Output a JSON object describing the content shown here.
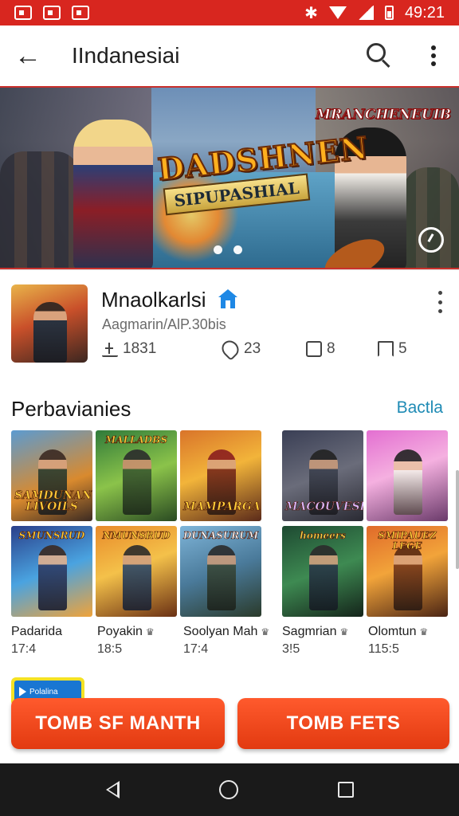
{
  "status_bar": {
    "time": "49:21"
  },
  "app_bar": {
    "title": "IIndanesiai"
  },
  "banner": {
    "title_line1": "DADSHNEN",
    "title_line2": "SIPUPASHIAL",
    "corner_badge": "MRANCHENEUIB"
  },
  "app": {
    "name": "Mnaolkarlsi",
    "subtitle": "Aagmarin/AlP.30bis",
    "stats": {
      "downloads": "1831",
      "likes": "23",
      "boxes": "8",
      "saves": "5"
    }
  },
  "section": {
    "title": "Perbavianies",
    "link": "Bactla"
  },
  "tiles": [
    {
      "caption": "SAMDUNAN LIVOILS",
      "name": "",
      "meta": ""
    },
    {
      "caption": "MALLADBS",
      "name": "",
      "meta": ""
    },
    {
      "caption": "MAMPARGA",
      "name": "",
      "meta": ""
    },
    {
      "caption": "MACOUVESER",
      "name": "",
      "meta": ""
    },
    {
      "caption": "",
      "name": "",
      "meta": ""
    },
    {
      "caption": "SMUNSRUD",
      "name": "Padarida",
      "meta": "17:4"
    },
    {
      "caption": "NMUNSRUD",
      "name": "Poyakin",
      "meta": "18:5"
    },
    {
      "caption": "DUNASURUM",
      "name": "Soolyan Mah",
      "meta": "17:4"
    },
    {
      "caption": "homeers",
      "name": "Sagmrian",
      "meta": "3!5"
    },
    {
      "caption": "SMIPAUEZ LEGE",
      "name": "Olomtun",
      "meta": "115:5"
    }
  ],
  "promo_chip": {
    "label": "Polalina"
  },
  "buttons": {
    "left": "TOMB SF MANTH",
    "right": "TOMB FETS"
  },
  "colors": {
    "status_bar": "#d8261f",
    "accent_link": "#1f8bb5",
    "cta": "#e23a10",
    "verify": "#1e88e5",
    "nav_bar": "#1a1a1a"
  },
  "icons": {
    "back": "arrow-left",
    "search": "magnifier",
    "more": "vertical-dots",
    "verified": "home-badge",
    "downloads": "download-tray",
    "likes": "heart",
    "boxes": "box",
    "saves": "bookmark",
    "replay": "replay"
  }
}
